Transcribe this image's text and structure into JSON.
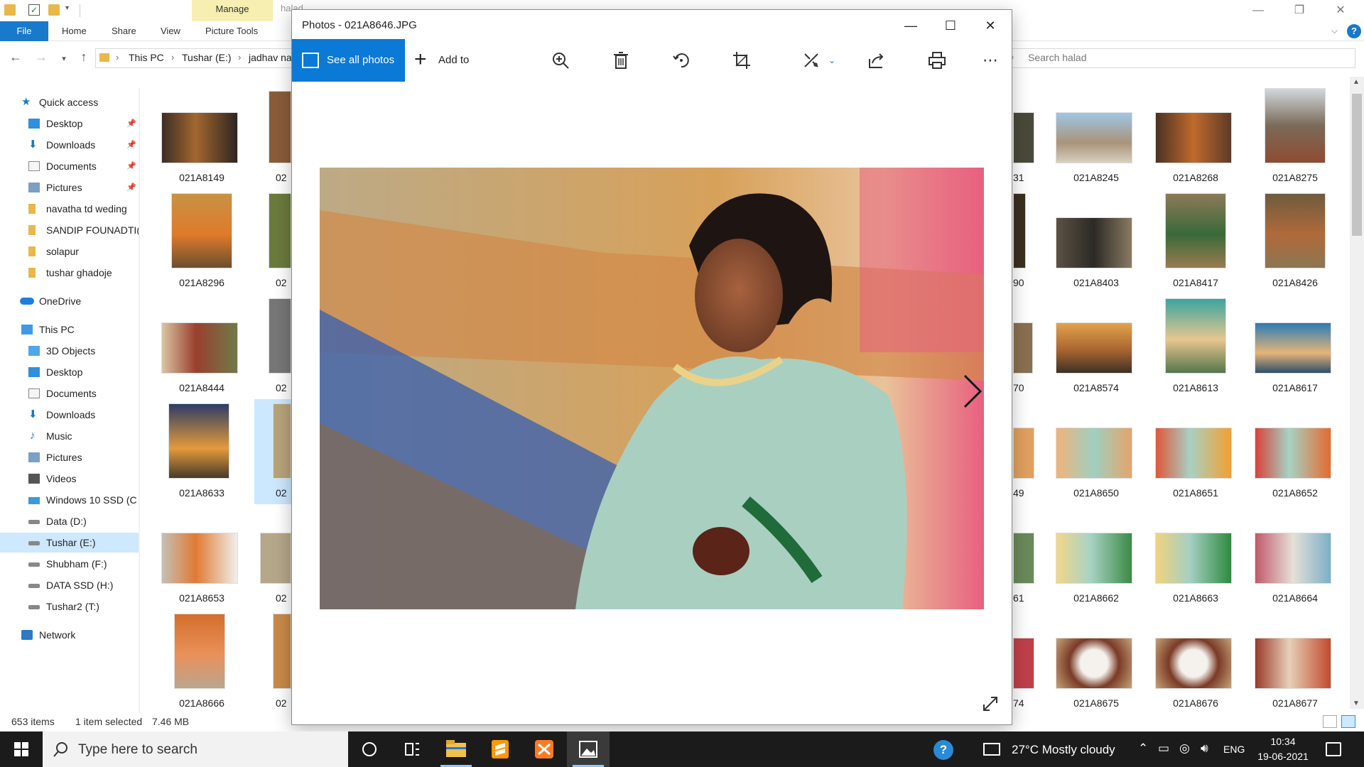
{
  "explorer": {
    "title": "halad",
    "contextual_tab_group": "Manage",
    "ribbon_tabs": [
      "File",
      "Home",
      "Share",
      "View",
      "Picture Tools"
    ],
    "breadcrumb": [
      "This PC",
      "Tushar (E:)",
      "jadhav na"
    ],
    "search_placeholder": "Search halad",
    "nav": {
      "quick_access": "Quick access",
      "quick_items": [
        "Desktop",
        "Downloads",
        "Documents",
        "Pictures",
        "navatha td weding",
        "SANDIP FOUNADTI(",
        "solapur",
        "tushar ghadoje"
      ],
      "onedrive": "OneDrive",
      "this_pc": "This PC",
      "pc_items": [
        "3D Objects",
        "Desktop",
        "Documents",
        "Downloads",
        "Music",
        "Pictures",
        "Videos",
        "Windows 10 SSD (C",
        "Data (D:)",
        "Tushar (E:)",
        "Shubham (F:)",
        "DATA SSD (H:)",
        "Tushar2 (T:)"
      ],
      "network": "Network"
    },
    "left_thumbs": [
      "021A8149",
      "021A8296",
      "021A8444",
      "021A8633",
      "021A8653",
      "021A8666"
    ],
    "partial_col_labels": [
      "02",
      "02",
      "02",
      "02",
      "02",
      "02"
    ],
    "right_partial_labels": [
      "31",
      "90",
      "70",
      "49",
      "61",
      "74"
    ],
    "right_grid": [
      [
        "021A8245",
        "021A8268",
        "021A8275"
      ],
      [
        "021A8403",
        "021A8417",
        "021A8426"
      ],
      [
        "021A8574",
        "021A8613",
        "021A8617"
      ],
      [
        "021A8650",
        "021A8651",
        "021A8652"
      ],
      [
        "021A8662",
        "021A8663",
        "021A8664"
      ],
      [
        "021A8675",
        "021A8676",
        "021A8677"
      ]
    ],
    "status": {
      "items": "653 items",
      "selected": "1 item selected",
      "size": "7.46 MB"
    }
  },
  "photos": {
    "title": "Photos - 021A8646.JPG",
    "see_all": "See all photos",
    "add_to": "Add to",
    "tools": [
      "zoom-icon",
      "delete-icon",
      "rotate-icon",
      "crop-icon",
      "edit-icon",
      "share-icon",
      "print-icon",
      "more-icon"
    ]
  },
  "taskbar": {
    "search_placeholder": "Type here to search",
    "weather": "27°C  Mostly cloudy",
    "language": "ENG",
    "time": "10:34",
    "date": "19-06-2021"
  },
  "colors": {
    "accent": "#0a7ad6",
    "file_tab": "#1979ca",
    "manage_tab": "#f6efb1",
    "taskbar": "#1b1b1b"
  }
}
